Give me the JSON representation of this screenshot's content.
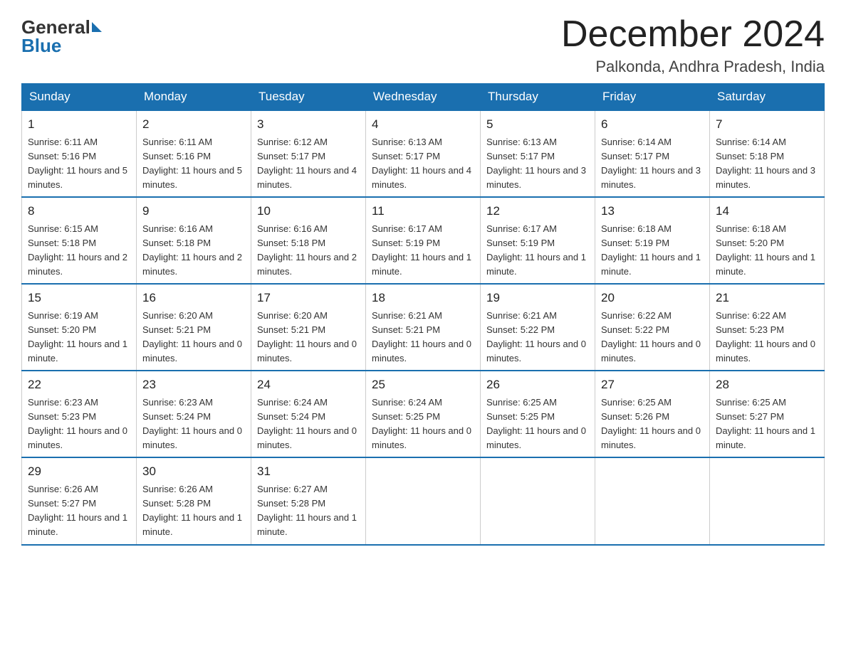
{
  "header": {
    "logo_general": "General",
    "logo_blue": "Blue",
    "month_title": "December 2024",
    "location": "Palkonda, Andhra Pradesh, India"
  },
  "weekdays": [
    "Sunday",
    "Monday",
    "Tuesday",
    "Wednesday",
    "Thursday",
    "Friday",
    "Saturday"
  ],
  "weeks": [
    [
      {
        "day": "1",
        "sunrise": "Sunrise: 6:11 AM",
        "sunset": "Sunset: 5:16 PM",
        "daylight": "Daylight: 11 hours and 5 minutes."
      },
      {
        "day": "2",
        "sunrise": "Sunrise: 6:11 AM",
        "sunset": "Sunset: 5:16 PM",
        "daylight": "Daylight: 11 hours and 5 minutes."
      },
      {
        "day": "3",
        "sunrise": "Sunrise: 6:12 AM",
        "sunset": "Sunset: 5:17 PM",
        "daylight": "Daylight: 11 hours and 4 minutes."
      },
      {
        "day": "4",
        "sunrise": "Sunrise: 6:13 AM",
        "sunset": "Sunset: 5:17 PM",
        "daylight": "Daylight: 11 hours and 4 minutes."
      },
      {
        "day": "5",
        "sunrise": "Sunrise: 6:13 AM",
        "sunset": "Sunset: 5:17 PM",
        "daylight": "Daylight: 11 hours and 3 minutes."
      },
      {
        "day": "6",
        "sunrise": "Sunrise: 6:14 AM",
        "sunset": "Sunset: 5:17 PM",
        "daylight": "Daylight: 11 hours and 3 minutes."
      },
      {
        "day": "7",
        "sunrise": "Sunrise: 6:14 AM",
        "sunset": "Sunset: 5:18 PM",
        "daylight": "Daylight: 11 hours and 3 minutes."
      }
    ],
    [
      {
        "day": "8",
        "sunrise": "Sunrise: 6:15 AM",
        "sunset": "Sunset: 5:18 PM",
        "daylight": "Daylight: 11 hours and 2 minutes."
      },
      {
        "day": "9",
        "sunrise": "Sunrise: 6:16 AM",
        "sunset": "Sunset: 5:18 PM",
        "daylight": "Daylight: 11 hours and 2 minutes."
      },
      {
        "day": "10",
        "sunrise": "Sunrise: 6:16 AM",
        "sunset": "Sunset: 5:18 PM",
        "daylight": "Daylight: 11 hours and 2 minutes."
      },
      {
        "day": "11",
        "sunrise": "Sunrise: 6:17 AM",
        "sunset": "Sunset: 5:19 PM",
        "daylight": "Daylight: 11 hours and 1 minute."
      },
      {
        "day": "12",
        "sunrise": "Sunrise: 6:17 AM",
        "sunset": "Sunset: 5:19 PM",
        "daylight": "Daylight: 11 hours and 1 minute."
      },
      {
        "day": "13",
        "sunrise": "Sunrise: 6:18 AM",
        "sunset": "Sunset: 5:19 PM",
        "daylight": "Daylight: 11 hours and 1 minute."
      },
      {
        "day": "14",
        "sunrise": "Sunrise: 6:18 AM",
        "sunset": "Sunset: 5:20 PM",
        "daylight": "Daylight: 11 hours and 1 minute."
      }
    ],
    [
      {
        "day": "15",
        "sunrise": "Sunrise: 6:19 AM",
        "sunset": "Sunset: 5:20 PM",
        "daylight": "Daylight: 11 hours and 1 minute."
      },
      {
        "day": "16",
        "sunrise": "Sunrise: 6:20 AM",
        "sunset": "Sunset: 5:21 PM",
        "daylight": "Daylight: 11 hours and 0 minutes."
      },
      {
        "day": "17",
        "sunrise": "Sunrise: 6:20 AM",
        "sunset": "Sunset: 5:21 PM",
        "daylight": "Daylight: 11 hours and 0 minutes."
      },
      {
        "day": "18",
        "sunrise": "Sunrise: 6:21 AM",
        "sunset": "Sunset: 5:21 PM",
        "daylight": "Daylight: 11 hours and 0 minutes."
      },
      {
        "day": "19",
        "sunrise": "Sunrise: 6:21 AM",
        "sunset": "Sunset: 5:22 PM",
        "daylight": "Daylight: 11 hours and 0 minutes."
      },
      {
        "day": "20",
        "sunrise": "Sunrise: 6:22 AM",
        "sunset": "Sunset: 5:22 PM",
        "daylight": "Daylight: 11 hours and 0 minutes."
      },
      {
        "day": "21",
        "sunrise": "Sunrise: 6:22 AM",
        "sunset": "Sunset: 5:23 PM",
        "daylight": "Daylight: 11 hours and 0 minutes."
      }
    ],
    [
      {
        "day": "22",
        "sunrise": "Sunrise: 6:23 AM",
        "sunset": "Sunset: 5:23 PM",
        "daylight": "Daylight: 11 hours and 0 minutes."
      },
      {
        "day": "23",
        "sunrise": "Sunrise: 6:23 AM",
        "sunset": "Sunset: 5:24 PM",
        "daylight": "Daylight: 11 hours and 0 minutes."
      },
      {
        "day": "24",
        "sunrise": "Sunrise: 6:24 AM",
        "sunset": "Sunset: 5:24 PM",
        "daylight": "Daylight: 11 hours and 0 minutes."
      },
      {
        "day": "25",
        "sunrise": "Sunrise: 6:24 AM",
        "sunset": "Sunset: 5:25 PM",
        "daylight": "Daylight: 11 hours and 0 minutes."
      },
      {
        "day": "26",
        "sunrise": "Sunrise: 6:25 AM",
        "sunset": "Sunset: 5:25 PM",
        "daylight": "Daylight: 11 hours and 0 minutes."
      },
      {
        "day": "27",
        "sunrise": "Sunrise: 6:25 AM",
        "sunset": "Sunset: 5:26 PM",
        "daylight": "Daylight: 11 hours and 0 minutes."
      },
      {
        "day": "28",
        "sunrise": "Sunrise: 6:25 AM",
        "sunset": "Sunset: 5:27 PM",
        "daylight": "Daylight: 11 hours and 1 minute."
      }
    ],
    [
      {
        "day": "29",
        "sunrise": "Sunrise: 6:26 AM",
        "sunset": "Sunset: 5:27 PM",
        "daylight": "Daylight: 11 hours and 1 minute."
      },
      {
        "day": "30",
        "sunrise": "Sunrise: 6:26 AM",
        "sunset": "Sunset: 5:28 PM",
        "daylight": "Daylight: 11 hours and 1 minute."
      },
      {
        "day": "31",
        "sunrise": "Sunrise: 6:27 AM",
        "sunset": "Sunset: 5:28 PM",
        "daylight": "Daylight: 11 hours and 1 minute."
      },
      null,
      null,
      null,
      null
    ]
  ]
}
